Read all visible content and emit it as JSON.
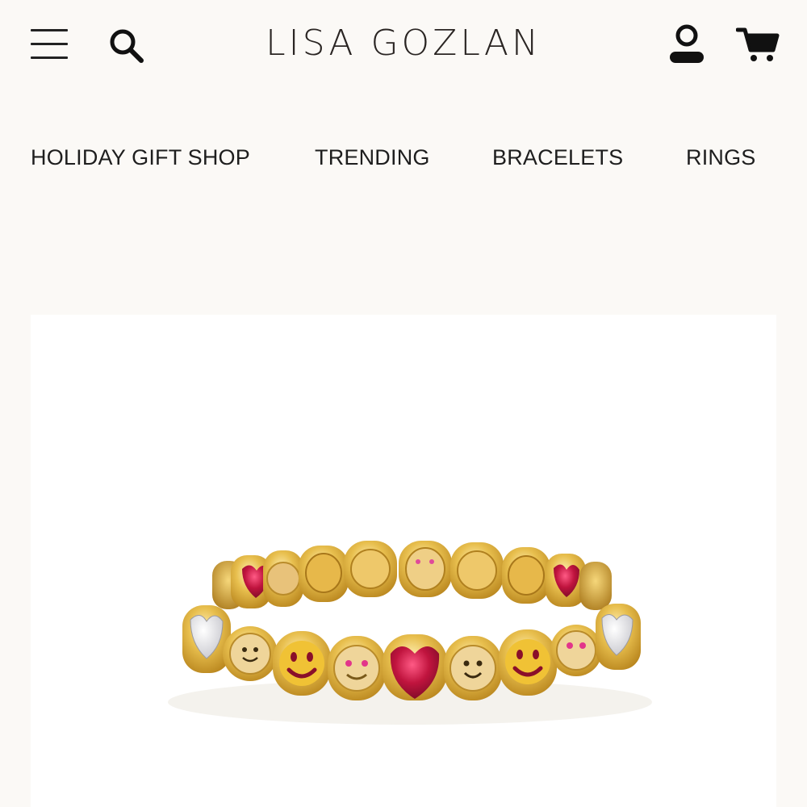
{
  "header": {
    "brand": "LISA GOZLAN",
    "menu_icon": "hamburger-menu-icon",
    "search_icon": "search-icon",
    "account_icon": "user-account-icon",
    "cart_icon": "shopping-cart-icon"
  },
  "nav": {
    "items": [
      {
        "label": "HOLIDAY GIFT SHOP"
      },
      {
        "label": "TRENDING"
      },
      {
        "label": "BRACELETS"
      },
      {
        "label": "RINGS"
      }
    ]
  },
  "product": {
    "image_subject": "gold-bracelet"
  },
  "colors": {
    "background": "#fbf9f6",
    "text": "#1e1e1e",
    "gold": "#d9a93a",
    "ruby": "#b0143c"
  }
}
